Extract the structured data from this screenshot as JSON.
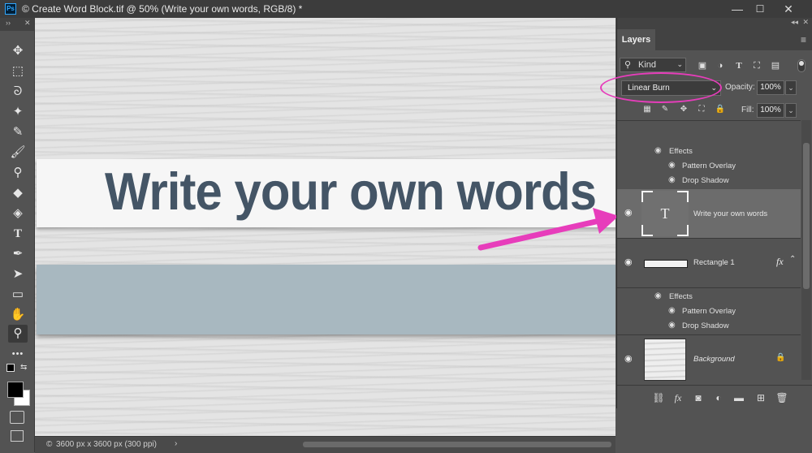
{
  "window": {
    "app_icon_label": "Ps",
    "title": "© Create Word Block.tif @ 50% (Write your own words, RGB/8) *",
    "minimize": "—",
    "maximize": "☐",
    "close": "✕"
  },
  "toolbar": {
    "collapse": "››",
    "close": "✕",
    "tools": [
      {
        "name": "move-tool",
        "glyph": "✥"
      },
      {
        "name": "marquee-tool",
        "glyph": "⬚"
      },
      {
        "name": "lasso-tool",
        "glyph": "ᘐ"
      },
      {
        "name": "magic-wand-tool",
        "glyph": "✦"
      },
      {
        "name": "eyedropper-tool",
        "glyph": "✎"
      },
      {
        "name": "brush-tool",
        "glyph": "🖌"
      },
      {
        "name": "stamp-tool",
        "glyph": "⚲"
      },
      {
        "name": "eraser-tool",
        "glyph": "◆"
      },
      {
        "name": "paint-bucket-tool",
        "glyph": "◈"
      },
      {
        "name": "type-tool",
        "glyph": "T"
      },
      {
        "name": "pen-tool",
        "glyph": "✒"
      },
      {
        "name": "path-selection-tool",
        "glyph": "➤"
      },
      {
        "name": "rectangle-tool",
        "glyph": "▭"
      },
      {
        "name": "hand-tool",
        "glyph": "✋"
      },
      {
        "name": "zoom-tool",
        "glyph": "⚲"
      },
      {
        "name": "more-tools",
        "glyph": "•••"
      }
    ]
  },
  "canvas": {
    "headline": "Write your own words"
  },
  "status": {
    "zoom_icon": "©",
    "doc_info": "3600 px x 3600 px (300 ppi)",
    "chevron": "›"
  },
  "layers_panel": {
    "panel_collapse": "◂◂",
    "panel_close": "✕",
    "tab": "Layers",
    "menu": "≡",
    "filter_kind": "Kind",
    "blend_mode": "Linear Burn",
    "opacity_label": "Opacity:",
    "opacity_value": "100%",
    "lock_label": "Lock:",
    "fill_label": "Fill:",
    "fill_value": "100%",
    "group1": {
      "effects": "Effects",
      "pattern_overlay": "Pattern Overlay",
      "drop_shadow": "Drop Shadow"
    },
    "text_layer": {
      "name": "Write your own words",
      "thumb_glyph": "T"
    },
    "rect_layer": {
      "name": "Rectangle 1",
      "fx": "fx"
    },
    "group2": {
      "effects": "Effects",
      "pattern_overlay": "Pattern Overlay",
      "drop_shadow": "Drop Shadow"
    },
    "background_layer": {
      "name": "Background"
    }
  },
  "colors": {
    "highlight": "#e73dbb",
    "text_color": "#445566",
    "rect_fill": "#a8b8c0"
  }
}
